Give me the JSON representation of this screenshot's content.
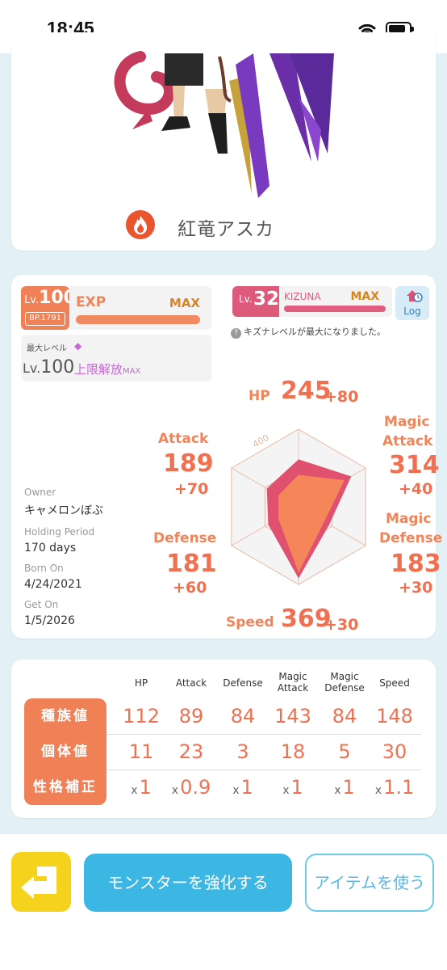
{
  "status_bar": {
    "time": "18:45"
  },
  "monster": {
    "name": "紅竜アスカ",
    "element_icon": "fire-icon"
  },
  "level": {
    "label": "Lv.",
    "value": "100",
    "bp": "BP.1791",
    "exp_label": "EXP",
    "exp_status": "MAX",
    "exp_fill": 1.0,
    "max_level_label": "最大レベル",
    "max_level_value_prefix": "Lv.",
    "max_level_value": "100",
    "limit_text": "上限解放",
    "limit_suffix": "MAX"
  },
  "kizuna": {
    "lv_label": "Lv.",
    "lv_value": "32",
    "label": "KIZUNA",
    "status": "MAX",
    "fill": 1.0,
    "note": "キズナレベルが最大になりました。",
    "log_label": "Log"
  },
  "owner": {
    "owner_label": "Owner",
    "owner_value": "キャメロンぼぶ",
    "holding_label": "Holding Period",
    "holding_value": "170 days",
    "born_label": "Born On",
    "born_value": "4/24/2021",
    "get_label": "Get On",
    "get_value": "1/5/2026"
  },
  "stats": {
    "hp": {
      "label": "HP",
      "value": "245",
      "bonus": "+80"
    },
    "attack": {
      "label": "Attack",
      "value": "189",
      "bonus": "+70"
    },
    "magic_attack": {
      "label_1": "Magic",
      "label_2": "Attack",
      "value": "314",
      "bonus": "+40"
    },
    "defense": {
      "label": "Defense",
      "value": "181",
      "bonus": "+60"
    },
    "magic_defense": {
      "label_1": "Magic",
      "label_2": "Defense",
      "value": "183",
      "bonus": "+30"
    },
    "speed": {
      "label": "Speed",
      "value": "369",
      "bonus": "+30"
    }
  },
  "radar": {
    "scale_label": "400",
    "scale_max": 400,
    "colors": {
      "total": "#e0506f",
      "base": "#f5865a",
      "grid": "#e8b8a0"
    }
  },
  "table": {
    "columns": [
      {
        "line1": "HP",
        "line2": ""
      },
      {
        "line1": "Attack",
        "line2": ""
      },
      {
        "line1": "Defense",
        "line2": ""
      },
      {
        "line1": "Magic",
        "line2": "Attack"
      },
      {
        "line1": "Magic",
        "line2": "Defense"
      },
      {
        "line1": "Speed",
        "line2": ""
      }
    ],
    "rows": [
      {
        "label": "種族値",
        "values": [
          "112",
          "89",
          "84",
          "143",
          "84",
          "148"
        ]
      },
      {
        "label": "個体値",
        "values": [
          "11",
          "23",
          "3",
          "18",
          "5",
          "30"
        ]
      },
      {
        "label": "性格補正",
        "prefix": "x",
        "values": [
          "1",
          "0.9",
          "1",
          "1",
          "1",
          "1.1"
        ]
      }
    ]
  },
  "actions": {
    "back_icon": "return-arrow-icon",
    "enhance_label": "モンスターを強化する",
    "item_label": "アイテムを使う"
  }
}
